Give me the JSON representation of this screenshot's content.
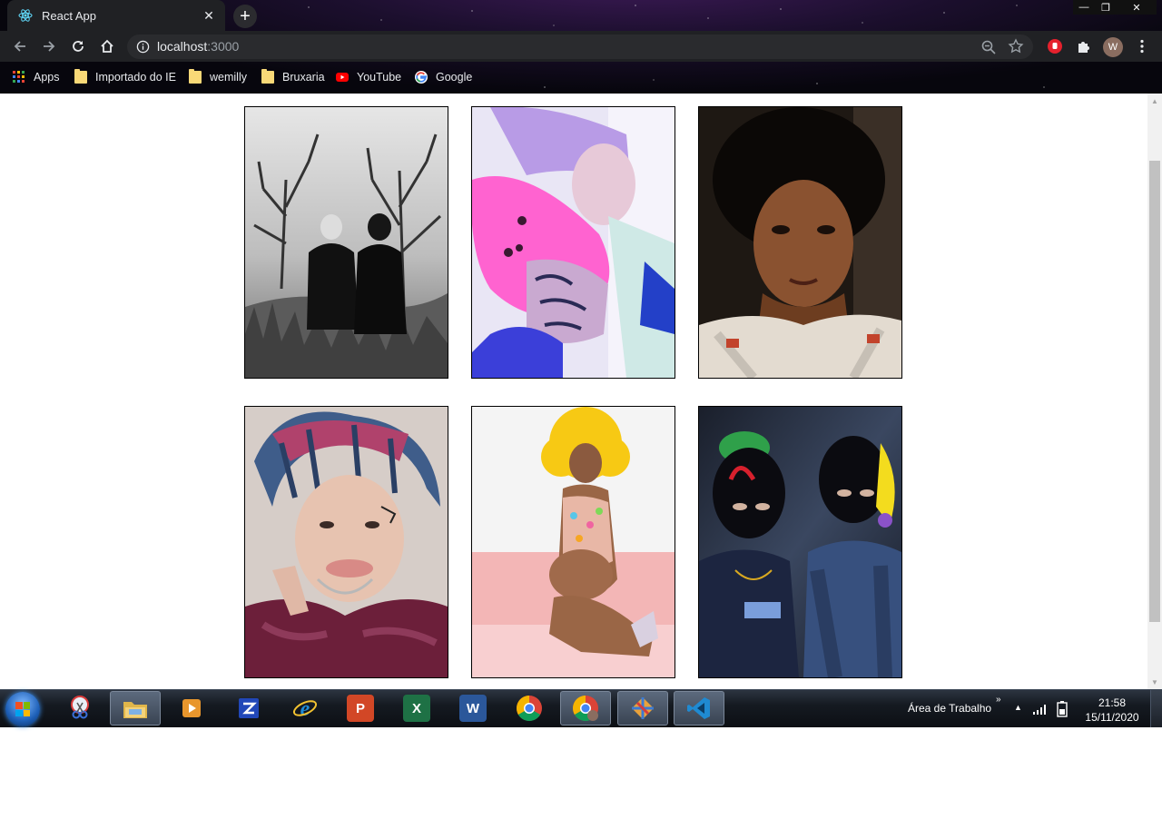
{
  "browser": {
    "tab_title": "React App",
    "tab_close": "✕",
    "new_tab": "+",
    "window_controls": {
      "minimize": "—",
      "restore": "❐",
      "close": "✕"
    },
    "url_host": "localhost",
    "url_port": ":3000",
    "bookmarks": [
      {
        "label": "Apps",
        "icon": "apps-grid-icon"
      },
      {
        "label": "Importado do IE",
        "icon": "folder-icon"
      },
      {
        "label": "wemilly",
        "icon": "folder-icon"
      },
      {
        "label": "Bruxaria",
        "icon": "folder-icon"
      },
      {
        "label": "YouTube",
        "icon": "youtube-icon"
      },
      {
        "label": "Google",
        "icon": "google-icon"
      }
    ],
    "profile_initial": "W"
  },
  "gallery": {
    "images": [
      {
        "name": "photo-bw-duo-trees",
        "palette": [
          "#dcdcdc",
          "#1a1a1a",
          "#7a7a7a"
        ]
      },
      {
        "name": "photo-pink-pillow-tattoo",
        "palette": [
          "#e9e6f5",
          "#ff63d0",
          "#3b3fd9"
        ]
      },
      {
        "name": "photo-curly-hair-portrait",
        "palette": [
          "#0e0b0a",
          "#6b3d24",
          "#d8c6b6"
        ]
      },
      {
        "name": "photo-colored-hair-selfie",
        "palette": [
          "#d8d0cc",
          "#6c1f3a",
          "#3f6ea3"
        ]
      },
      {
        "name": "photo-yellow-wig-pink-set",
        "palette": [
          "#f4f4f4",
          "#f7c914",
          "#f3b6b6"
        ]
      },
      {
        "name": "photo-balaclava-duo",
        "palette": [
          "#1b2130",
          "#0b0b0f",
          "#37507e"
        ]
      }
    ]
  },
  "taskbar": {
    "desktop_label": "Área de Trabalho",
    "chevron": "»",
    "time": "21:58",
    "date": "15/11/2020",
    "apps": [
      {
        "name": "snipping-tool",
        "color": "#d93b3b"
      },
      {
        "name": "file-explorer",
        "color": "#e0b64a"
      },
      {
        "name": "media-player",
        "color": "#e8962d"
      },
      {
        "name": "app-blue-z",
        "color": "#2147b8"
      },
      {
        "name": "internet-explorer",
        "color": "#1e8ad6"
      },
      {
        "name": "powerpoint",
        "color": "#d24726"
      },
      {
        "name": "excel",
        "color": "#1e7145"
      },
      {
        "name": "word",
        "color": "#2b579a"
      },
      {
        "name": "chrome",
        "color": "#db4437"
      },
      {
        "name": "chrome-profile",
        "color": "#db4437"
      },
      {
        "name": "app-gem",
        "color": "#e9a23b"
      },
      {
        "name": "vscode",
        "color": "#1f8ad2"
      }
    ]
  }
}
